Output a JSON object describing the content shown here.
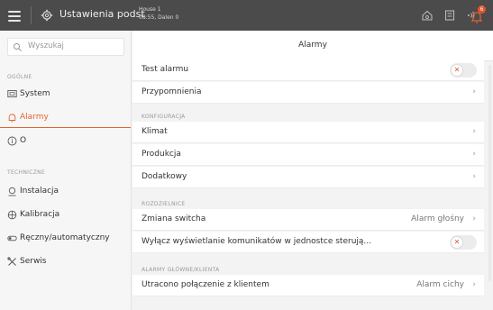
{
  "topbar": {
    "app_title": "Ustawienia podst",
    "house_name": "House 1",
    "house_info": "08:55, Dalen 0",
    "notification_count": "6"
  },
  "sidebar": {
    "search_placeholder": "Wyszukaj",
    "sections": {
      "general": "OGÓLNE",
      "technical": "TECHNICZNE"
    },
    "items": [
      {
        "label": "System",
        "icon": "monitor-icon"
      },
      {
        "label": "Alarmy",
        "icon": "bell-icon",
        "active": true
      },
      {
        "label": "O",
        "icon": "info-icon"
      },
      {
        "label": "Instalacja",
        "icon": "installation-icon"
      },
      {
        "label": "Kalibracja",
        "icon": "calibration-icon"
      },
      {
        "label": "Ręczny/automatyczny",
        "icon": "manual-auto-icon"
      },
      {
        "label": "Serwis",
        "icon": "wrench-icon"
      }
    ]
  },
  "main": {
    "title": "Alarmy",
    "rows": {
      "test_alarm": "Test alarmu",
      "reminders": "Przypomnienia"
    },
    "configuration": {
      "section": "KONFIGURACJA",
      "climate": "Klimat",
      "production": "Produkcja",
      "additional": "Dodatkowy"
    },
    "switchboards": {
      "section": "ROZDZIELNICE",
      "switch_change": "Zmiana switcha",
      "switch_change_value": "Alarm głośny",
      "disable_messages": "Wyłącz wyświetlanie komunikatów w jednostce sterują..."
    },
    "client_alarms": {
      "section": "ALARMY GŁÓWNE/KLIENTA",
      "lost_connection": "Utracono połączenie z klientem",
      "lost_connection_value": "Alarm cichy"
    }
  },
  "colors": {
    "accent": "#e5632f",
    "topbar": "#4b4b4b",
    "badge": "#e5532f"
  }
}
